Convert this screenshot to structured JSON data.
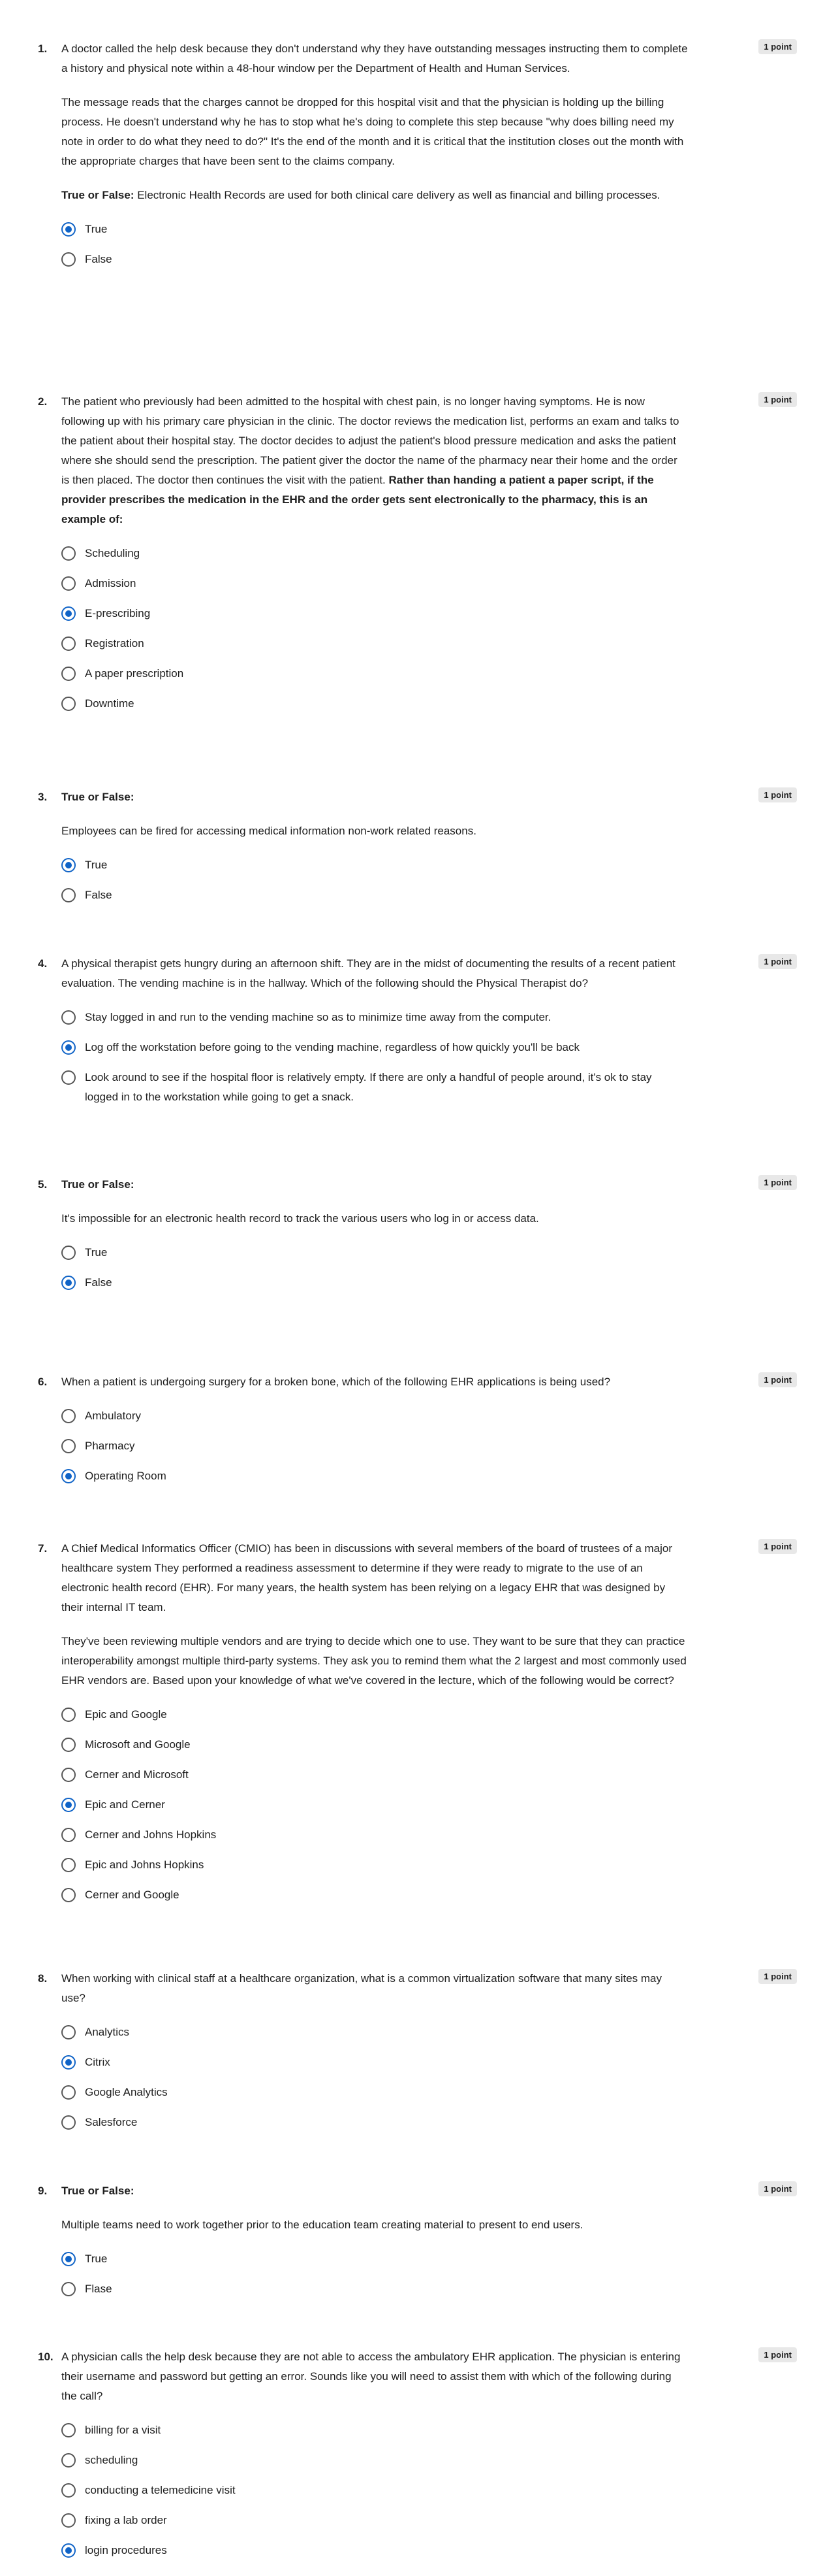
{
  "questions": [
    {
      "num": "1.",
      "points": "1 point",
      "paragraphs": [
        [
          {
            "t": "A doctor called the help desk because they don't understand why they have outstanding messages instructing them to complete a history and physical note within a 48-hour window per the Department of Health and Human Services."
          }
        ],
        [
          {
            "t": "The message reads that the charges cannot be dropped for this hospital visit and that the physician is holding up the billing process. He doesn't understand why he has to stop what he's doing to complete this step because \"why does billing need my note in order to do what they need to do?\" It's the end of the month and it is critical that the institution closes out the month with the appropriate charges that have been sent to the claims company."
          }
        ],
        [
          {
            "t": "True or False: ",
            "b": true
          },
          {
            "t": "Electronic Health Records are used for both clinical care delivery as well as financial and billing processes."
          }
        ]
      ],
      "options": [
        "True",
        "False"
      ],
      "selected": 0
    },
    {
      "num": "2.",
      "points": "1 point",
      "paragraphs": [
        [
          {
            "t": "The patient who previously had been admitted to the hospital with chest pain, is no longer having symptoms. He is now following up with his primary care physician in the clinic. The doctor reviews the medication list, performs an exam and talks to the patient about their hospital stay. The doctor decides to adjust the patient's blood pressure medication and asks the patient where she should send the prescription. The patient giver the doctor the name of the pharmacy near their home and the order is then placed. The doctor then continues the visit with the patient. "
          },
          {
            "t": "Rather than handing a patient a paper script, if the provider prescribes the medication in the EHR and the order gets sent electronically to the pharmacy, this is an example of:",
            "b": true
          }
        ]
      ],
      "options": [
        "Scheduling",
        "Admission",
        "E-prescribing",
        "Registration",
        "A paper prescription",
        "Downtime"
      ],
      "selected": 2
    },
    {
      "num": "3.",
      "points": "1 point",
      "paragraphs": [
        [
          {
            "t": "True or False:",
            "b": true
          }
        ],
        [
          {
            "t": "Employees can be fired for accessing medical information non-work related reasons."
          }
        ]
      ],
      "options": [
        "True",
        "False"
      ],
      "selected": 0
    },
    {
      "num": "4.",
      "points": "1 point",
      "paragraphs": [
        [
          {
            "t": " A physical therapist gets hungry during an afternoon shift. They are in the midst of documenting the results of a recent patient evaluation. The vending machine is in the hallway. Which of the following should the Physical Therapist do?"
          }
        ]
      ],
      "options": [
        "Stay logged in and run to the vending machine so as to minimize time away from the computer.",
        "Log off the workstation before going to the vending machine, regardless of how quickly you'll be back",
        "Look around to see if the hospital floor is relatively empty. If there are only a handful of people around, it's ok to stay logged in to the workstation while going to get a snack."
      ],
      "selected": 1
    },
    {
      "num": "5.",
      "points": "1 point",
      "paragraphs": [
        [
          {
            "t": "True or False:",
            "b": true
          }
        ],
        [
          {
            "t": "It's impossible for an electronic health record to track the various users who log in or access data."
          }
        ]
      ],
      "options": [
        "True",
        "False"
      ],
      "selected": 1
    },
    {
      "num": "6.",
      "points": "1 point",
      "paragraphs": [
        [
          {
            "t": "When a patient is undergoing surgery for a broken bone, which of the following EHR applications is being used?"
          }
        ]
      ],
      "options": [
        "Ambulatory",
        "Pharmacy",
        "Operating Room"
      ],
      "selected": 2
    },
    {
      "num": "7.",
      "points": "1 point",
      "paragraphs": [
        [
          {
            "t": "A Chief Medical Informatics Officer (CMIO) has been in discussions with several members of the board of trustees of a major healthcare system They performed a readiness assessment to determine if they were ready to migrate to the use of an electronic health record (EHR). For many years, the health system has been relying on a legacy EHR that was designed by their internal IT team."
          }
        ],
        [
          {
            "t": "They've been reviewing multiple vendors and are trying to decide which one to use. They want to be sure that they can practice interoperability amongst multiple third-party systems. They ask you to remind them what the 2 largest and most commonly used EHR vendors are. Based upon your knowledge of what we've covered in the lecture, which of the following would be correct?"
          }
        ]
      ],
      "options": [
        "Epic and Google",
        "Microsoft and Google",
        "Cerner and Microsoft",
        "Epic and Cerner",
        "Cerner and Johns Hopkins",
        "Epic and Johns Hopkins",
        "Cerner and Google"
      ],
      "selected": 3
    },
    {
      "num": "8.",
      "points": "1 point",
      "paragraphs": [
        [
          {
            "t": "When working with clinical staff at a healthcare organization, what is a common virtualization software that many sites may use?"
          }
        ]
      ],
      "options": [
        "Analytics",
        "Citrix",
        "Google Analytics",
        "Salesforce"
      ],
      "selected": 1
    },
    {
      "num": "9.",
      "points": "1 point",
      "paragraphs": [
        [
          {
            "t": "True or False:",
            "b": true
          }
        ],
        [
          {
            "t": "Multiple teams need to work together prior to the education team creating material to present to end users."
          }
        ]
      ],
      "options": [
        "True",
        "Flase"
      ],
      "selected": 0
    },
    {
      "num": "10.",
      "points": "1 point",
      "paragraphs": [
        [
          {
            "t": "A physician calls the help desk because they are not able to access the ambulatory EHR application. The physician is entering their username and password but getting an error. Sounds like you will need to assist them with which of the following during the call?"
          }
        ]
      ],
      "options": [
        "billing for a visit",
        "scheduling",
        "conducting a telemedicine visit",
        "fixing a lab order",
        "login procedures"
      ],
      "selected": 4
    }
  ]
}
